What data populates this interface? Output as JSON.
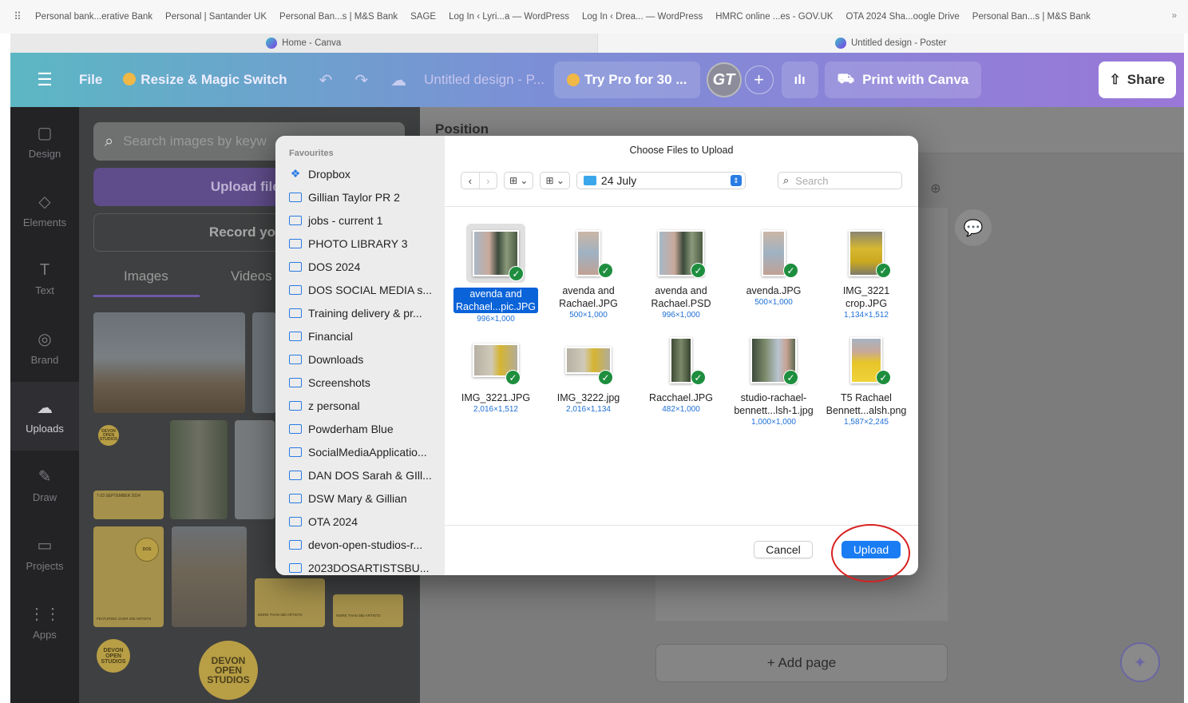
{
  "bookmarks": [
    "Personal bank...erative Bank",
    "Personal | Santander UK",
    "Personal Ban...s | M&S Bank",
    "SAGE",
    "Log In ‹ Lyri...a — WordPress",
    "Log In ‹ Drea... — WordPress",
    "HMRC online ...es - GOV.UK",
    "OTA 2024 Sha...oogle Drive",
    "Personal Ban...s | M&S Bank"
  ],
  "bookmarks_more": "»",
  "browser_tabs": [
    {
      "label": "Home - Canva"
    },
    {
      "label": "Untitled design - Poster"
    }
  ],
  "topbar": {
    "menu_icon": "☰",
    "file": "File",
    "resize": "Resize & Magic Switch",
    "undo": "↶",
    "redo": "↷",
    "cloud": "☁",
    "title": "Untitled design - P...",
    "try_pro": "Try Pro for 30 ...",
    "avatar": "GT",
    "plus": "+",
    "stats": "ılı",
    "print": "Print with Canva",
    "share": "Share"
  },
  "rail": [
    {
      "label": "Design",
      "icon": "▢"
    },
    {
      "label": "Elements",
      "icon": "◇"
    },
    {
      "label": "Text",
      "icon": "T"
    },
    {
      "label": "Brand",
      "icon": "◎"
    },
    {
      "label": "Uploads",
      "icon": "☁"
    },
    {
      "label": "Draw",
      "icon": "✎"
    },
    {
      "label": "Projects",
      "icon": "▭"
    },
    {
      "label": "Apps",
      "icon": "⋮⋮"
    }
  ],
  "panel": {
    "search_placeholder": "Search images by keyw",
    "upload_files": "Upload files",
    "record": "Record your",
    "tab_images": "Images",
    "tab_videos": "Videos",
    "badge_small": "DEVON OPEN STUDIOS",
    "badge_big": "DEVON OPEN STUDIOS",
    "yellow1_text": "7-23 SEPTEMBER 2024",
    "yellow2_text": "FEATURING OVER 400 ARTISTS",
    "yellow3_text": "MORE THAN 350 ARTISTS",
    "yellow4_text": "MORE THAN 350 ARTISTS"
  },
  "canvas": {
    "position": "Position",
    "add_page": "+ Add page",
    "magic_icon": "✦"
  },
  "dialog": {
    "title": "Choose Files to Upload",
    "favourites_head": "Favourites",
    "favourites": [
      "Dropbox",
      "Gillian Taylor PR 2",
      "jobs - current 1",
      "PHOTO LIBRARY 3",
      "DOS 2024",
      "DOS SOCIAL MEDIA s...",
      "Training delivery & pr...",
      "Financial",
      "Downloads",
      "Screenshots",
      "z personal",
      "Powderham Blue",
      "SocialMediaApplicatio...",
      "DAN DOS Sarah & GIll...",
      "DSW Mary & Gillian",
      "OTA 2024",
      "devon-open-studios-r...",
      "2023DOSARTISTSBU..."
    ],
    "back": "‹",
    "forward": "›",
    "view_grid": "⊞ ⌄",
    "view_group": "⊞ ⌄",
    "location": "24 July",
    "search_placeholder": "Search",
    "files": [
      {
        "name1": "avenda and",
        "name2": "Rachael...pic.JPG",
        "dims": "996×1,000",
        "selected": true
      },
      {
        "name1": "avenda and",
        "name2": "Rachael.JPG",
        "dims": "500×1,000"
      },
      {
        "name1": "avenda and",
        "name2": "Rachael.PSD",
        "dims": "996×1,000"
      },
      {
        "name1": "avenda.JPG",
        "name2": "",
        "dims": "500×1,000"
      },
      {
        "name1": "IMG_3221",
        "name2": "crop.JPG",
        "dims": "1,134×1,512"
      },
      {
        "name1": "IMG_3221.JPG",
        "name2": "",
        "dims": "2,016×1,512"
      },
      {
        "name1": "IMG_3222.jpg",
        "name2": "",
        "dims": "2,016×1,134"
      },
      {
        "name1": "Racchael.JPG",
        "name2": "",
        "dims": "482×1,000"
      },
      {
        "name1": "studio-rachael-",
        "name2": "bennett...lsh-1.jpg",
        "dims": "1,000×1,000"
      },
      {
        "name1": "T5 Rachael",
        "name2": "Bennett...alsh.png",
        "dims": "1,587×2,245"
      }
    ],
    "cancel": "Cancel",
    "upload": "Upload"
  },
  "colors": {
    "accent": "#1a7cf2",
    "canva_purple": "#7d2ae8",
    "highlight_ring": "#d92020"
  }
}
